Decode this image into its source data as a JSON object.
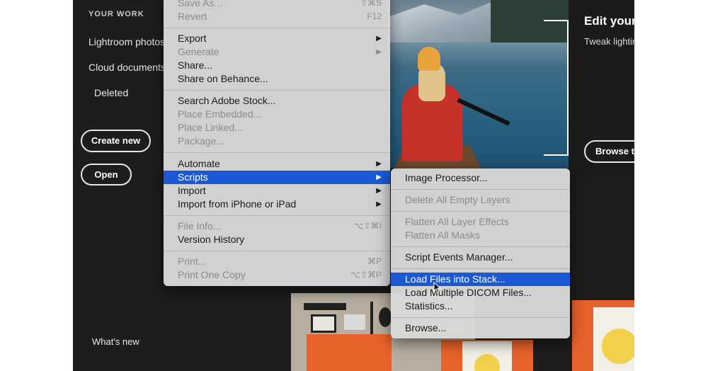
{
  "sidebar": {
    "heading": "YOUR WORK",
    "items": [
      "Lightroom photos",
      "Cloud documents",
      "Deleted"
    ],
    "create_label": "Create new",
    "open_label": "Open",
    "whats_new": "What's new"
  },
  "promo": {
    "title": "Edit your",
    "subtitle": "Tweak lightin",
    "button_label": "Browse tu"
  },
  "file_menu": {
    "save_as": {
      "label": "Save As...",
      "shortcut": "⇧⌘S"
    },
    "revert": {
      "label": "Revert",
      "shortcut": "F12"
    },
    "export": "Export",
    "generate": "Generate",
    "share": "Share...",
    "share_behance": "Share on Behance...",
    "search_stock": "Search Adobe Stock...",
    "place_embedded": "Place Embedded...",
    "place_linked": "Place Linked...",
    "package": "Package...",
    "automate": "Automate",
    "scripts": "Scripts",
    "import": "Import",
    "import_iphone": "Import from iPhone or iPad",
    "file_info": {
      "label": "File Info...",
      "shortcut": "⌥⇧⌘I"
    },
    "version_history": "Version History",
    "print": {
      "label": "Print...",
      "shortcut": "⌘P"
    },
    "print_one": {
      "label": "Print One Copy",
      "shortcut": "⌥⇧⌘P"
    }
  },
  "scripts_menu": {
    "image_processor": "Image Processor...",
    "delete_empty_layers": "Delete All Empty Layers",
    "flatten_effects": "Flatten All Layer Effects",
    "flatten_masks": "Flatten All Masks",
    "script_events": "Script Events Manager...",
    "load_stack": "Load Files into Stack...",
    "load_dicom": "Load Multiple DICOM Files...",
    "statistics": "Statistics...",
    "browse": "Browse..."
  },
  "colors": {
    "highlight": "#1a58d4",
    "menu_bg": "#d8d8d8",
    "app_bg": "#1d1d1d"
  },
  "icons": [
    "submenu-arrow-icon",
    "mouse-cursor-icon"
  ]
}
